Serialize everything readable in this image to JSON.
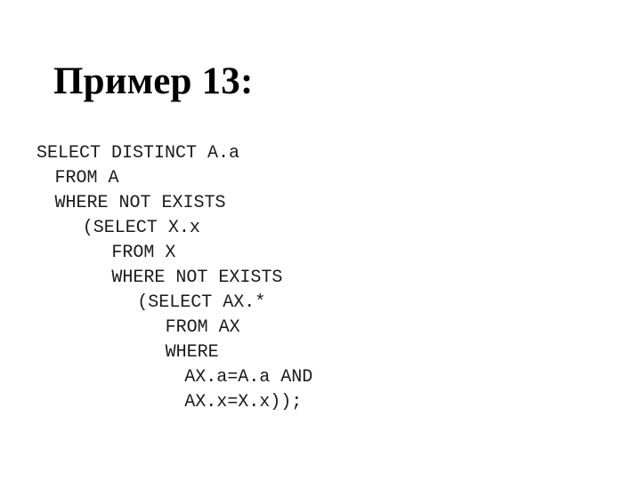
{
  "slide": {
    "title": "Пример 13:",
    "background_color": "#ffffff",
    "title_color": "#000000",
    "code_color": "#1a1a1a",
    "code": {
      "language": "sql",
      "lines": [
        {
          "indent_chars": 0,
          "text": "SELECT DISTINCT A.a"
        },
        {
          "indent_chars": 1.7,
          "text": "FROM A"
        },
        {
          "indent_chars": 1.7,
          "text": "WHERE NOT EXISTS"
        },
        {
          "indent_chars": 4.3,
          "text": "(SELECT X.x"
        },
        {
          "indent_chars": 7.0,
          "text": "FROM X"
        },
        {
          "indent_chars": 7.0,
          "text": "WHERE NOT EXISTS"
        },
        {
          "indent_chars": 9.4,
          "text": "(SELECT AX.*"
        },
        {
          "indent_chars": 12.0,
          "text": "FROM AX"
        },
        {
          "indent_chars": 12.0,
          "text": "WHERE"
        },
        {
          "indent_chars": 13.8,
          "text": "AX.a=A.a AND"
        },
        {
          "indent_chars": 13.8,
          "text": "AX.x=X.x));"
        }
      ],
      "full_text": "SELECT DISTINCT A.a\n  FROM A\n  WHERE NOT EXISTS\n    (SELECT X.x\n      FROM X\n      WHERE NOT EXISTS\n        (SELECT AX.*\n          FROM AX\n          WHERE\n            AX.a=A.a AND\n            AX.x=X.x));"
    }
  }
}
